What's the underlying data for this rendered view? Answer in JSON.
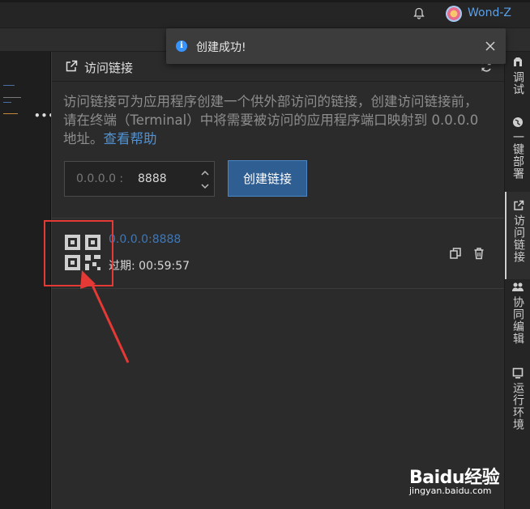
{
  "header": {
    "username": "Wond-Z"
  },
  "toast": {
    "message": "创建成功!"
  },
  "panel": {
    "title": "访问链接",
    "description": "访问链接可为应用程序创建一个供外部访问的链接，创建访问链接前，请在终端（Terminal）中将需要被访问的应用程序端口映射到 0.0.0.0 地址。",
    "help_link": "查看帮助",
    "port_prefix": "0.0.0.0 :",
    "port_value": "8888",
    "create_button": "创建链接",
    "links": [
      {
        "url": "0.0.0.0:8888",
        "expire": "过期: 00:59:57"
      }
    ]
  },
  "sidebar": {
    "items": [
      {
        "label": "调试",
        "icon": "bug-icon"
      },
      {
        "label": "一键部署",
        "icon": "globe-icon"
      },
      {
        "label": "访问链接",
        "icon": "external-link-icon",
        "active": true
      },
      {
        "label": "协同编辑",
        "icon": "people-icon"
      },
      {
        "label": "运行环境",
        "icon": "monitor-icon"
      }
    ]
  },
  "watermark": {
    "logo": "Bai⁠du经验",
    "url": "jingyan.baidu.com"
  },
  "colors": {
    "accent": "#2f5e93",
    "link": "#4f93d6",
    "annotation": "#e53935"
  }
}
